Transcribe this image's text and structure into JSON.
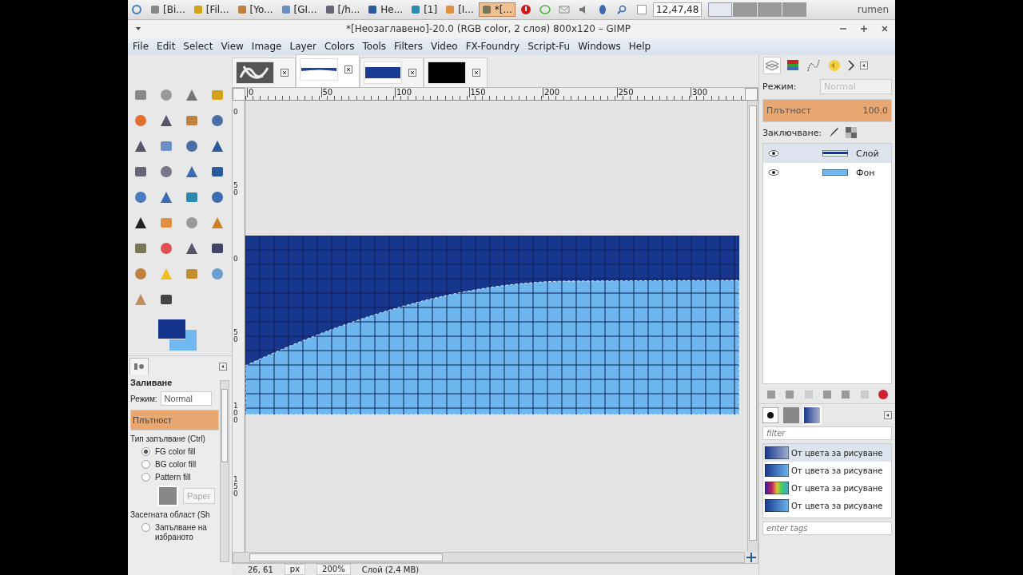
{
  "taskbar": {
    "items": [
      {
        "label": "[Bi...",
        "selected": false
      },
      {
        "label": "[Fil...",
        "selected": false
      },
      {
        "label": "[Yo...",
        "selected": false
      },
      {
        "label": "[GI...",
        "selected": false
      },
      {
        "label": "[/h...",
        "selected": false
      },
      {
        "label": "He...",
        "selected": false
      },
      {
        "label": "[1]",
        "selected": false
      },
      {
        "label": "[I...",
        "selected": false
      },
      {
        "label": "*[...",
        "selected": true
      }
    ],
    "clock": "12,47,48",
    "user": "rumen"
  },
  "window": {
    "title": "*[Неозаглавено]-20.0 (RGB color, 2 слоя) 800x120 – GIMP"
  },
  "menu": [
    "File",
    "Edit",
    "Select",
    "View",
    "Image",
    "Layer",
    "Colors",
    "Tools",
    "Filters",
    "Video",
    "FX-Foundry",
    "Script-Fu",
    "Windows",
    "Help"
  ],
  "image_tabs": [
    {
      "kind": "noise",
      "selected": false
    },
    {
      "kind": "stroke",
      "selected": true
    },
    {
      "kind": "bar",
      "selected": false
    },
    {
      "kind": "black",
      "selected": false
    }
  ],
  "tool_options": {
    "title": "Заливане",
    "mode_label": "Режим:",
    "mode": "Normal",
    "opacity": {
      "label": "Плътност",
      "level": 1
    },
    "fill_type_label": "Тип запълване  (Ctrl)",
    "fill_types": [
      {
        "label": "FG color fill",
        "selected": true
      },
      {
        "label": "BG color fill",
        "selected": false
      },
      {
        "label": "Pattern fill",
        "selected": false
      }
    ],
    "pattern_name": "Paper",
    "area_label": "Засегната област  (Sh",
    "area_options": [
      {
        "label": "Запълване на избраното",
        "selected": false
      }
    ]
  },
  "rulers": {
    "x_labels": [
      "0",
      "50",
      "100",
      "150",
      "200",
      "250",
      "300"
    ],
    "y_labels": [
      "0",
      "50",
      "0",
      "50",
      "100",
      "150"
    ]
  },
  "layers_dock": {
    "mode_label": "Режим:",
    "mode": "Normal",
    "opacity": {
      "label": "Плътност",
      "value": "100.0",
      "level": 1
    },
    "lock_label": "Заключване:",
    "layers": [
      {
        "name": "Слой",
        "visible": true,
        "selected": true,
        "kind": "stroke"
      },
      {
        "name": "Фон",
        "visible": true,
        "selected": false,
        "kind": "bar"
      }
    ]
  },
  "gradients": {
    "filter_placeholder": "filter",
    "tags_placeholder": "enter tags",
    "items": [
      {
        "name": "От цвета за рисуване",
        "selected": true,
        "kind": "checker"
      },
      {
        "name": "От цвета за рисуване",
        "selected": false,
        "kind": "blue"
      },
      {
        "name": "От цвета за рисуване",
        "selected": false,
        "kind": "rainbow"
      },
      {
        "name": "От цвета за рисуване",
        "selected": false,
        "kind": "blue"
      }
    ]
  },
  "status_bar": {
    "coords": "26, 61",
    "unit": "px",
    "zoom": "200%",
    "info": "Слой (2,4 MB)"
  }
}
